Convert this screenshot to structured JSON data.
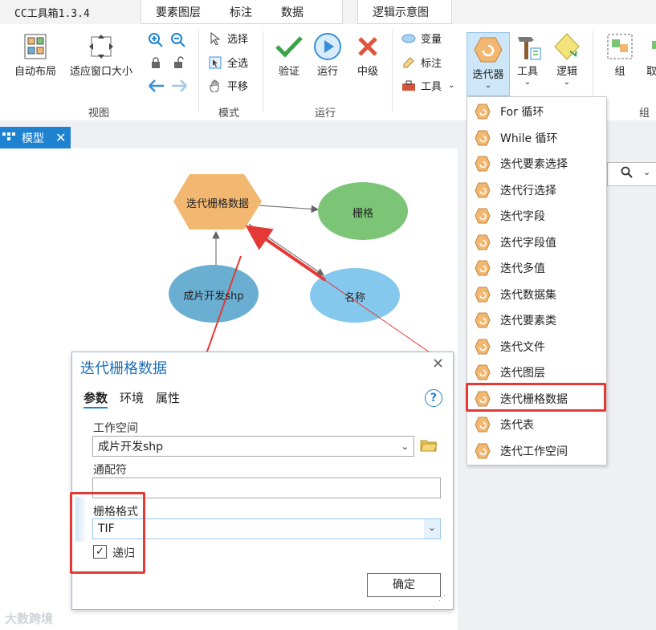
{
  "app": {
    "title": "CC工具箱1.3.4"
  },
  "top_tabs": {
    "features": "要素图层",
    "annotation": "标注",
    "data": "数据",
    "logic": "逻辑示意图"
  },
  "ribbon": {
    "auto_layout": "自动布局",
    "fit_window": "适应窗口大小",
    "select": "选择",
    "select_all": "全选",
    "pan": "平移",
    "validate": "验证",
    "run": "运行",
    "stop": "中级",
    "variable": "变量",
    "label": "标注",
    "tools_small": "工具",
    "iterator": "迭代器",
    "tools": "工具",
    "logic": "逻辑",
    "group": "组",
    "ungroup": "取消",
    "groups": {
      "view": "视图",
      "mode": "模式",
      "run": "运行",
      "group": "组"
    }
  },
  "model_tab": {
    "label": "模型"
  },
  "model_nodes": {
    "iterate_raster": "迭代栅格数据",
    "raster": "栅格",
    "input": "成片开发shp",
    "name": "名称"
  },
  "iterator_menu": {
    "items": [
      "For 循环",
      "While 循环",
      "迭代要素选择",
      "迭代行选择",
      "迭代字段",
      "迭代字段值",
      "迭代多值",
      "迭代数据集",
      "迭代要素类",
      "迭代文件",
      "迭代图层",
      "迭代栅格数据",
      "迭代表",
      "迭代工作空间"
    ]
  },
  "dialog": {
    "title": "迭代栅格数据",
    "tab_params": "参数",
    "tab_env": "环境",
    "tab_props": "属性",
    "help": "?",
    "workspace_label": "工作空间",
    "workspace_value": "成片开发shp",
    "wildcard_label": "通配符",
    "wildcard_value": "",
    "raster_format_label": "栅格格式",
    "raster_format_value": "TIF",
    "recursive_label": "递归",
    "recursive_checked": true,
    "ok": "确定"
  },
  "watermark": "大数跨境",
  "colors": {
    "accent": "#1f82d1",
    "highlight": "#e53935",
    "hexagon": "#f2b872",
    "raster_node": "#7cc576",
    "input_node": "#6aaed1",
    "name_node": "#85c8ee"
  }
}
